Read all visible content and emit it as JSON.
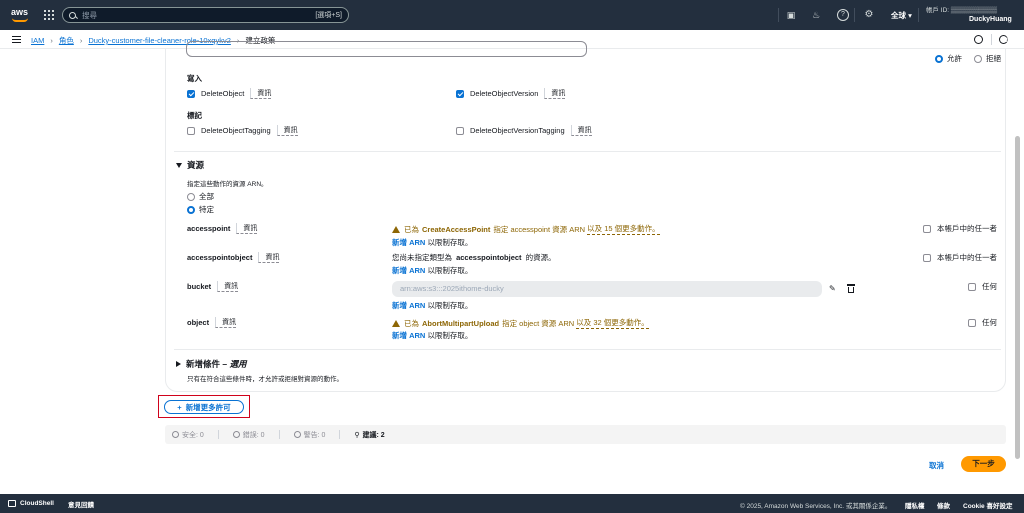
{
  "topnav": {
    "logo": "aws",
    "search_placeholder": "搜尋",
    "search_shortcut": "[選項+S]",
    "icons": [
      "cloudshell-icon",
      "bell-icon",
      "help-icon",
      "gear-icon"
    ],
    "region_label": "全球",
    "account_id_label": "帳戶 ID: ▒▒▒▒▒▒▒▒▒▒",
    "user_name": "DuckyHuang"
  },
  "breadcrumb": {
    "items": [
      "IAM",
      "角色",
      "Ducky-customer-file-cleaner-role-10xqykv2"
    ],
    "current": "建立政策"
  },
  "effect": {
    "allow_label": "允許",
    "deny_label": "拒絕",
    "selected": "allow"
  },
  "write_group": {
    "title": "寫入",
    "items": [
      {
        "label": "DeleteObject",
        "info": "資訊",
        "checked": true
      },
      {
        "label": "DeleteObjectVersion",
        "info": "資訊",
        "checked": true
      }
    ]
  },
  "tag_group": {
    "title": "標記",
    "items": [
      {
        "label": "DeleteObjectTagging",
        "info": "資訊",
        "checked": false
      },
      {
        "label": "DeleteObjectVersionTagging",
        "info": "資訊",
        "checked": false
      }
    ]
  },
  "resources": {
    "title": "資源",
    "description": "指定這些動作的資源 ARN。",
    "option_all": "全部",
    "option_specific": "特定",
    "selected": "specific",
    "rows": [
      {
        "name": "accesspoint",
        "info": "資訊",
        "warn_prefix": "已為",
        "warn_action": "CreateAccessPoint",
        "warn_mid": "指定 accesspoint 資源 ARN",
        "warn_link": "以及 15 個更多動作。",
        "add_link": "新增 ARN",
        "add_suffix": "以限制存取。",
        "right_label": "本帳戶中的任一者"
      },
      {
        "name": "accesspointobject",
        "info": "資訊",
        "plain_prefix": "您尚未指定類型為",
        "plain_bold": "accesspointobject",
        "plain_suffix": "的資源。",
        "add_link": "新增 ARN",
        "add_suffix": "以限制存取。",
        "right_label": "本帳戶中的任一者"
      },
      {
        "name": "bucket",
        "info": "資訊",
        "arn_value": "arn:aws:s3:::2025ithome-ducky",
        "add_link": "新增 ARN",
        "add_suffix": "以限制存取。",
        "right_label": "任何"
      },
      {
        "name": "object",
        "info": "資訊",
        "warn_prefix": "已為",
        "warn_action": "AbortMultipartUpload",
        "warn_mid": "指定 object 資源 ARN",
        "warn_link": "以及 32 個更多動作。",
        "add_link": "新增 ARN",
        "add_suffix": "以限制存取。",
        "right_label": "任何"
      }
    ]
  },
  "conditions": {
    "title": "新增條件",
    "optional": "– 選用",
    "description": "只有在符合這些條件時，才允許或拒絕對資源的動作。"
  },
  "add_more_permissions": "新增更多許可",
  "status_bar": {
    "security": "安全: 0",
    "errors": "錯誤: 0",
    "warnings": "警告: 0",
    "suggestions": "建議: 2"
  },
  "actions": {
    "cancel": "取消",
    "next": "下一步"
  },
  "footer": {
    "cloudshell": "CloudShell",
    "feedback": "意見回饋",
    "copyright": "© 2025, Amazon Web Services, Inc. 或其關係企業。",
    "privacy": "隱私權",
    "terms": "條款",
    "cookie": "Cookie 喜好設定"
  },
  "colors": {
    "nav_bg": "#232f3e",
    "link": "#0972d3",
    "warning": "#8d6605",
    "primary_button": "#ff9900",
    "highlight_box": "#d0021b"
  }
}
